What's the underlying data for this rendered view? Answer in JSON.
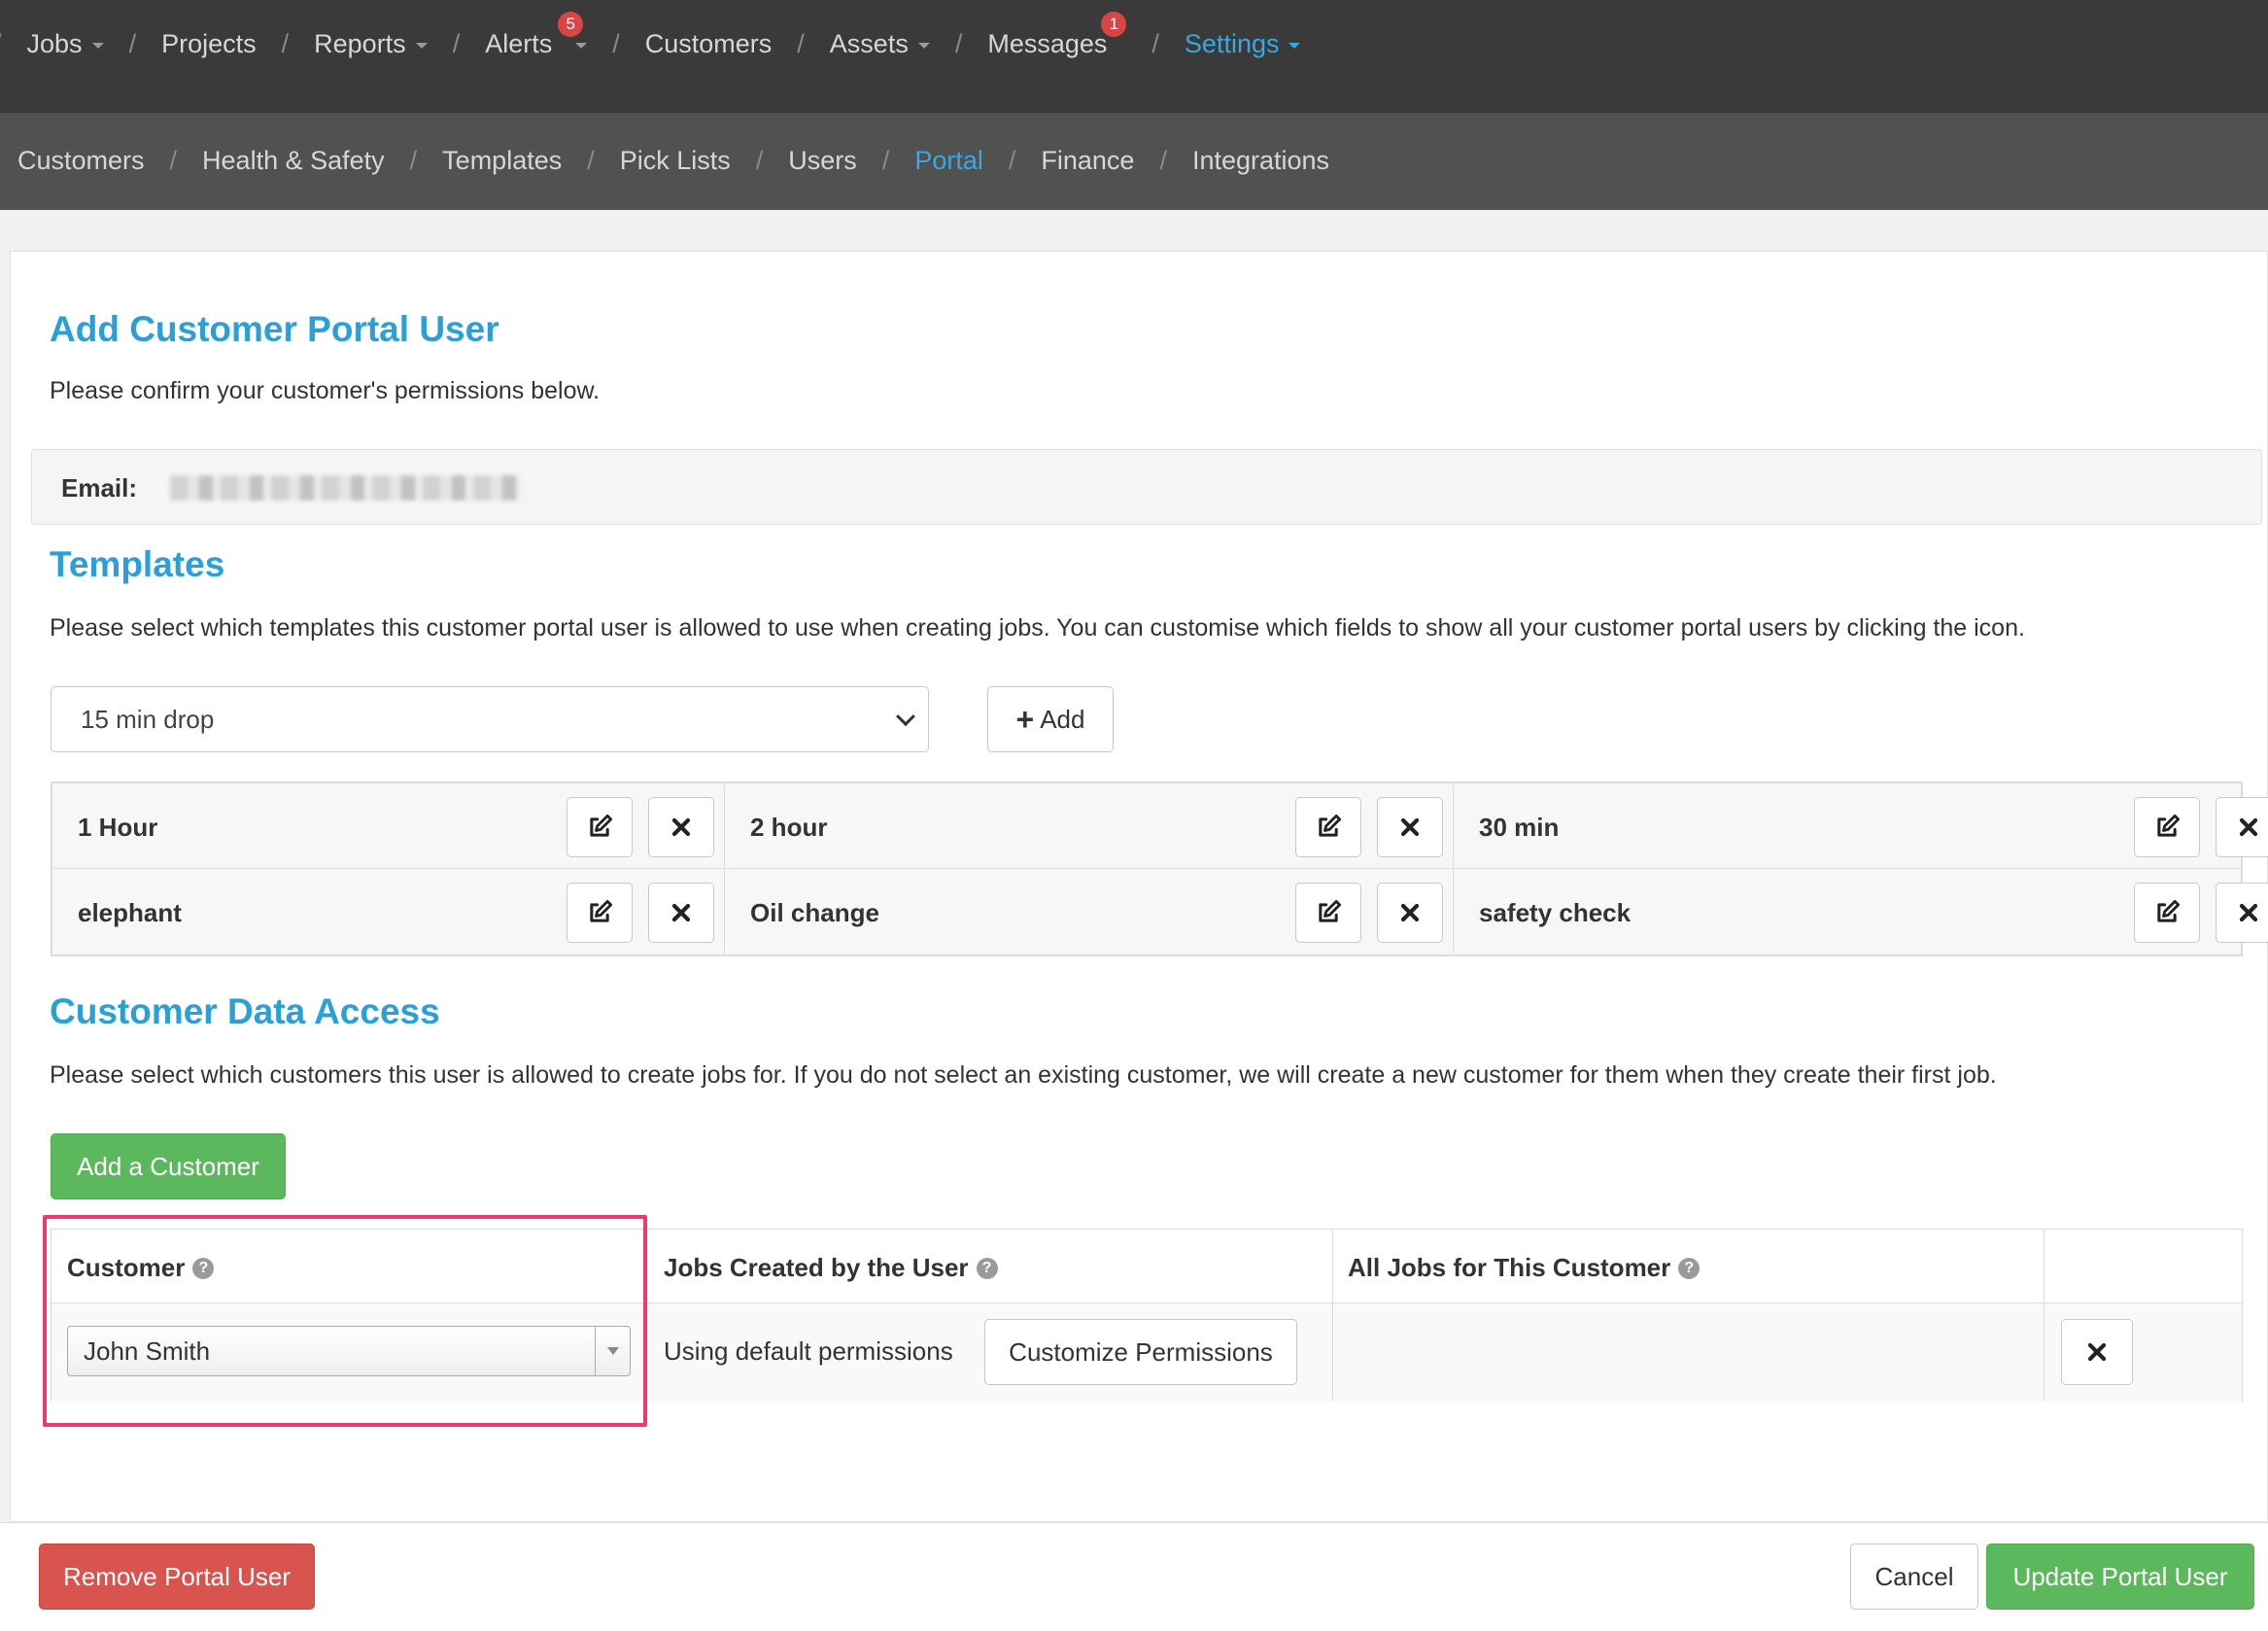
{
  "topnav": {
    "items": [
      {
        "label": "Jobs",
        "dropdown": true
      },
      {
        "label": "Projects",
        "dropdown": false
      },
      {
        "label": "Reports",
        "dropdown": true
      },
      {
        "label": "Alerts",
        "dropdown": true,
        "badge": "5"
      },
      {
        "label": "Customers",
        "dropdown": false
      },
      {
        "label": "Assets",
        "dropdown": true
      },
      {
        "label": "Messages",
        "dropdown": false,
        "badge": "1"
      },
      {
        "label": "Settings",
        "dropdown": true,
        "active": true
      }
    ]
  },
  "subnav": {
    "items": [
      {
        "label": "Customers"
      },
      {
        "label": "Health & Safety"
      },
      {
        "label": "Templates"
      },
      {
        "label": "Pick Lists"
      },
      {
        "label": "Users"
      },
      {
        "label": "Portal",
        "active": true
      },
      {
        "label": "Finance"
      },
      {
        "label": "Integrations"
      }
    ]
  },
  "page": {
    "title": "Add Customer Portal User",
    "subtitle": "Please confirm your customer's permissions below.",
    "email_label": "Email:"
  },
  "templates": {
    "heading": "Templates",
    "description": "Please select which templates this customer portal user is allowed to use when creating jobs. You can customise which fields to show all your customer portal users by clicking the icon.",
    "select_value": "15 min drop",
    "add_label": "Add",
    "items": [
      "1 Hour",
      "2 hour",
      "30 min",
      "elephant",
      "Oil change",
      "safety check"
    ]
  },
  "customer_access": {
    "heading": "Customer Data Access",
    "description": "Please select which customers this user is allowed to create jobs for. If you do not select an existing customer, we will create a new customer for them when they create their first job.",
    "add_customer_label": "Add a Customer",
    "columns": [
      "Customer",
      "Jobs Created by the User",
      "All Jobs for This Customer"
    ],
    "row": {
      "customer": "John Smith",
      "permissions_text": "Using default permissions",
      "customize_label": "Customize Permissions"
    }
  },
  "footer": {
    "remove_label": "Remove Portal User",
    "cancel_label": "Cancel",
    "update_label": "Update Portal User"
  },
  "colors": {
    "accent": "#2b9fd8",
    "topnav_bg": "#3a3a3a",
    "subnav_bg": "#515151",
    "success": "#5cb85c",
    "danger": "#d9534f",
    "highlight": "#f0386f"
  }
}
